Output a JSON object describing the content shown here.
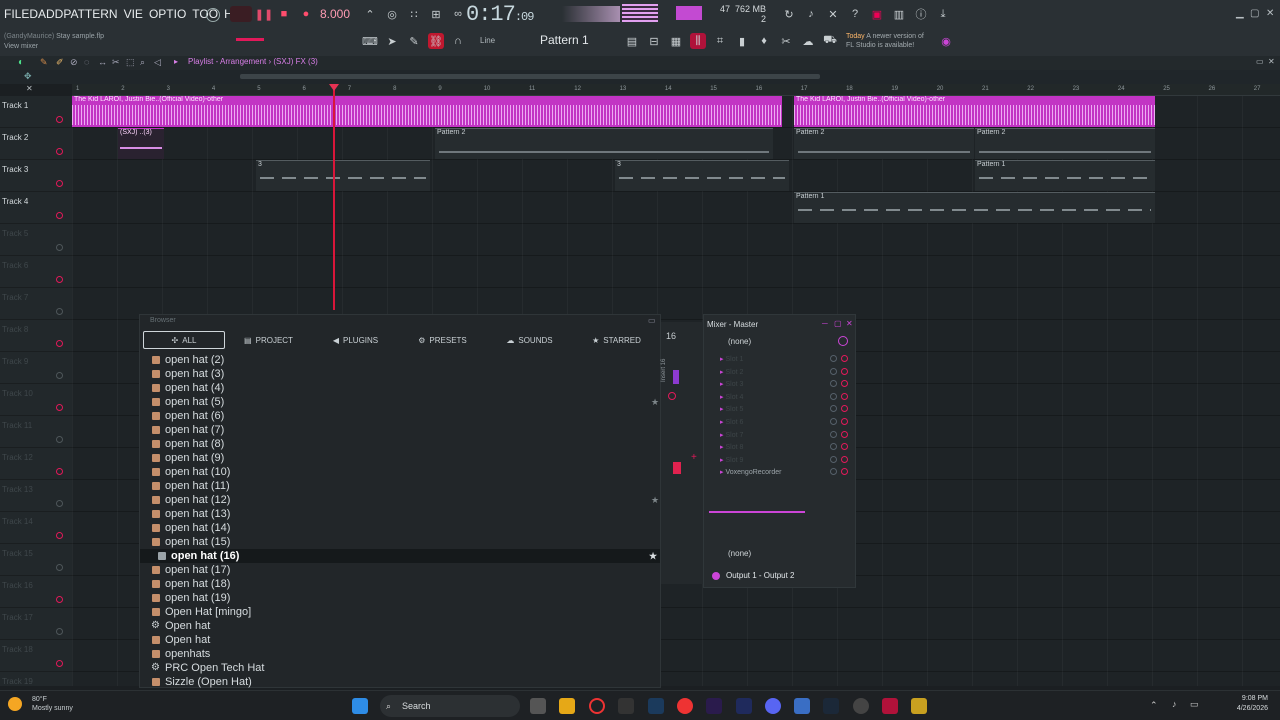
{
  "menu": [
    "FILE",
    "EDIT",
    "ADD",
    "PATTERNS",
    "VIEW",
    "OPTIONS",
    "TOOLS",
    "HELP"
  ],
  "menu_visible": [
    "FILE",
    "D",
    "ADD",
    "PATTERN",
    "VIE",
    "OPTIO",
    "TOO",
    "HEL"
  ],
  "hint": {
    "user": "(GandyMaurice)",
    "file": "Stay sample.flp",
    "view": "View mixer"
  },
  "tempo": "8.000",
  "clock": {
    "main": "0:17",
    "sub": ":09"
  },
  "cpu": {
    "value": "47",
    "mem": "762 MB",
    "poly": "2"
  },
  "pattern_name": "Pattern 1",
  "snap": "Line",
  "news": {
    "today": "Today",
    "text1": "A newer version of",
    "text2": "FL Studio is available!"
  },
  "playlist": {
    "title": "Playlist - Arrangement",
    "breadcrumb": "(SXJ) FX (3)"
  },
  "ruler": [
    "1",
    "2",
    "3",
    "4",
    "5",
    "6",
    "7",
    "8",
    "9",
    "10",
    "11",
    "12",
    "13",
    "14",
    "15",
    "16",
    "17",
    "18",
    "19",
    "20",
    "21",
    "22",
    "23",
    "24",
    "25",
    "26",
    "27"
  ],
  "tracks": [
    {
      "name": "Track 1",
      "dim": false
    },
    {
      "name": "Track 2",
      "dim": false
    },
    {
      "name": "Track 3",
      "dim": false
    },
    {
      "name": "Track 4",
      "dim": false
    },
    {
      "name": "Track 5",
      "dim": true
    },
    {
      "name": "Track 6",
      "dim": true
    },
    {
      "name": "Track 7",
      "dim": true
    },
    {
      "name": "Track 8",
      "dim": true
    },
    {
      "name": "Track 9",
      "dim": true
    },
    {
      "name": "Track 10",
      "dim": true
    },
    {
      "name": "Track 11",
      "dim": true
    },
    {
      "name": "Track 12",
      "dim": true
    },
    {
      "name": "Track 13",
      "dim": true
    },
    {
      "name": "Track 14",
      "dim": true
    },
    {
      "name": "Track 15",
      "dim": true
    },
    {
      "name": "Track 16",
      "dim": true
    },
    {
      "name": "Track 17",
      "dim": true
    },
    {
      "name": "Track 18",
      "dim": true
    },
    {
      "name": "Track 19",
      "dim": true
    }
  ],
  "clips": {
    "audio": "The Kid LAROI, Justin Bie..(Official Video)-other",
    "audio_short": "The Kid LAROI, Justin B..(Official Video)-other",
    "fx": "(SXJ) ..(3)",
    "pattern2": "Pattern 2",
    "pattern1": "Pattern 1",
    "p3": "3"
  },
  "browser": {
    "title": "Browser",
    "tabs": [
      "ALL",
      "PROJECT",
      "PLUGINS",
      "PRESETS",
      "SOUNDS",
      "STARRED"
    ],
    "items": [
      {
        "label": "open hat (2)",
        "type": "file",
        "selected": false,
        "star": false
      },
      {
        "label": "open hat (3)",
        "type": "file",
        "selected": false,
        "star": false
      },
      {
        "label": "open hat (4)",
        "type": "file",
        "selected": false,
        "star": false
      },
      {
        "label": "open hat (5)",
        "type": "file",
        "selected": false,
        "star": false
      },
      {
        "label": "open hat (6)",
        "type": "file",
        "selected": false,
        "star": false
      },
      {
        "label": "open hat (7)",
        "type": "file",
        "selected": false,
        "star": false
      },
      {
        "label": "open hat (8)",
        "type": "file",
        "selected": false,
        "star": false
      },
      {
        "label": "open hat (9)",
        "type": "file",
        "selected": false,
        "star": false
      },
      {
        "label": "open hat (10)",
        "type": "file",
        "selected": false,
        "star": false
      },
      {
        "label": "open hat (11)",
        "type": "file",
        "selected": false,
        "star": false
      },
      {
        "label": "open hat (12)",
        "type": "file",
        "selected": false,
        "star": false
      },
      {
        "label": "open hat (13)",
        "type": "file",
        "selected": false,
        "star": false
      },
      {
        "label": "open hat (14)",
        "type": "file",
        "selected": false,
        "star": false
      },
      {
        "label": "open hat (15)",
        "type": "file",
        "selected": false,
        "star": false
      },
      {
        "label": "open hat (16)",
        "type": "file",
        "selected": true,
        "star": true
      },
      {
        "label": "open hat (17)",
        "type": "file",
        "selected": false,
        "star": false
      },
      {
        "label": "open hat (18)",
        "type": "file",
        "selected": false,
        "star": false
      },
      {
        "label": "open hat (19)",
        "type": "file",
        "selected": false,
        "star": false
      },
      {
        "label": "Open Hat [mingo]",
        "type": "file",
        "selected": false,
        "star": false
      },
      {
        "label": "Open hat",
        "type": "preset",
        "selected": false,
        "star": false
      },
      {
        "label": "Open hat",
        "type": "file",
        "selected": false,
        "star": false
      },
      {
        "label": "openhats",
        "type": "file",
        "selected": false,
        "star": false
      },
      {
        "label": "PRC Open Tech Hat",
        "type": "preset",
        "selected": false,
        "star": false
      },
      {
        "label": "Sizzle (Open Hat)",
        "type": "file",
        "selected": false,
        "star": false
      }
    ]
  },
  "mixer": {
    "title": "Mixer - Master",
    "insert_number": "16",
    "insert_label": "Insert 16",
    "input": "(none)",
    "slots": [
      "Slot 1",
      "Slot 2",
      "Slot 3",
      "Slot 4",
      "Slot 5",
      "Slot 6",
      "Slot 7",
      "Slot 8",
      "Slot 9"
    ],
    "plugin": "VoxengoRecorder",
    "send": "(none)",
    "output": "Output 1 - Output 2"
  },
  "taskbar": {
    "temp": "80°F",
    "weather": "Mostly sunny",
    "search": "Search",
    "time": "9:08 PM",
    "date": "4/26/2026"
  },
  "colors": {
    "accent": "#c234c4",
    "record": "#e2195a",
    "background": "#1e2326"
  }
}
